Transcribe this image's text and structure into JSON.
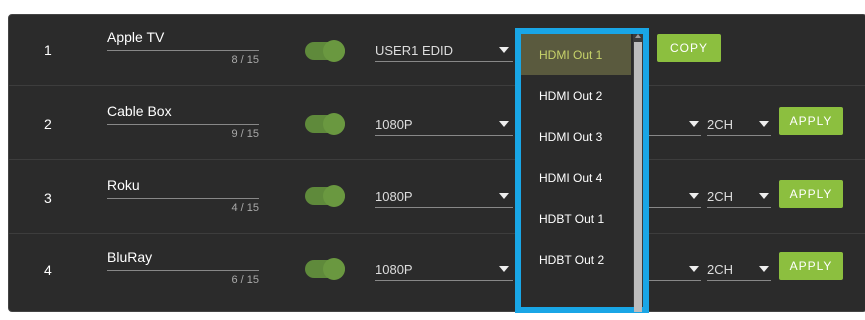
{
  "rows": [
    {
      "index": "1",
      "name": "Apple TV",
      "counter": "8 / 15",
      "format": "USER1 EDID",
      "action": "COPY"
    },
    {
      "index": "2",
      "name": "Cable Box",
      "counter": "9 / 15",
      "format": "1080P",
      "audio": "2CH",
      "action": "APPLY"
    },
    {
      "index": "3",
      "name": "Roku",
      "counter": "4 / 15",
      "format": "1080P",
      "audio": "2CH",
      "action": "APPLY"
    },
    {
      "index": "4",
      "name": "BluRay",
      "counter": "6 / 15",
      "format": "1080P",
      "audio": "2CH",
      "action": "APPLY"
    }
  ],
  "dropdown": {
    "options": [
      "HDMI Out 1",
      "HDMI Out 2",
      "HDMI Out 3",
      "HDMI Out 4",
      "HDBT Out 1",
      "HDBT Out 2"
    ],
    "selected": "HDMI Out 1"
  },
  "colors": {
    "accent": "#8cbf3f",
    "toggle": "#5f8a3b",
    "highlight": "#19a6e6",
    "panel": "#2b2b2b"
  }
}
